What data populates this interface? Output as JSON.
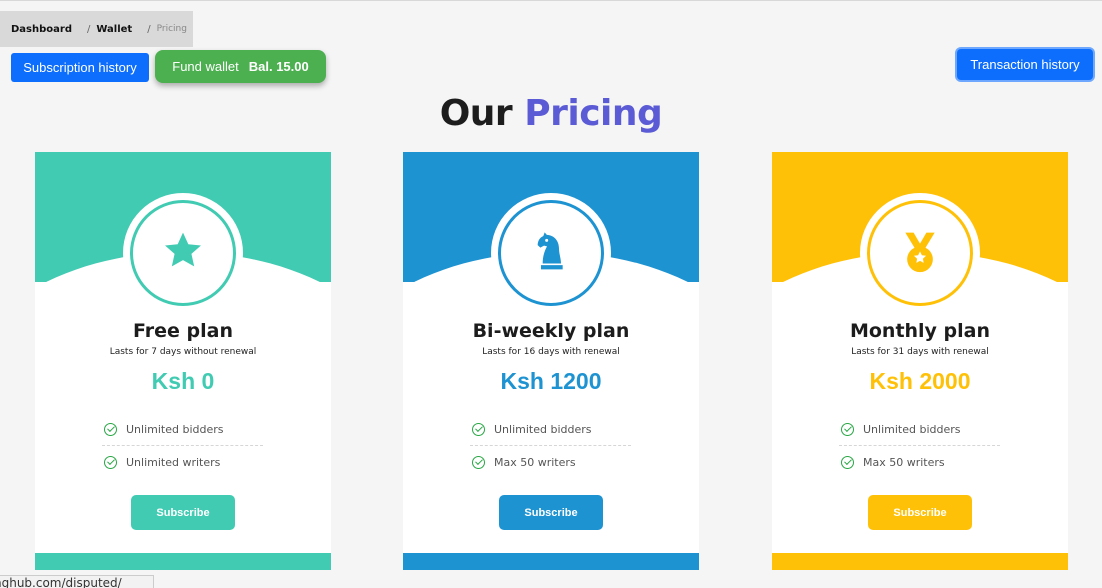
{
  "breadcrumb": {
    "items": [
      "Dashboard",
      "Wallet",
      "Pricing"
    ],
    "separator": "/"
  },
  "toolbar": {
    "subscription_history": "Subscription history",
    "fund_wallet": "Fund wallet",
    "balance": "Bal. 15.00",
    "transaction_history": "Transaction history"
  },
  "heading": {
    "part1": "Our",
    "part2": "Pricing"
  },
  "plans": [
    {
      "name": "Free plan",
      "description": "Lasts for 7 days without renewal",
      "price": "Ksh 0",
      "features": [
        "Unlimited bidders",
        "Unlimited writers"
      ],
      "cta": "Subscribe",
      "color": "#41cbb2",
      "icon": "star-icon"
    },
    {
      "name": "Bi-weekly plan",
      "description": "Lasts for 16 days with renewal",
      "price": "Ksh 1200",
      "features": [
        "Unlimited bidders",
        "Max 50 writers"
      ],
      "cta": "Subscribe",
      "color": "#1e93d2",
      "icon": "chess-knight-icon"
    },
    {
      "name": "Monthly plan",
      "description": "Lasts for 31 days with renewal",
      "price": "Ksh 2000",
      "features": [
        "Unlimited bidders",
        "Max 50 writers"
      ],
      "cta": "Subscribe",
      "color": "#ffc107",
      "icon": "medal-icon"
    }
  ],
  "status_bar": {
    "url": "nghub.com/disputed/"
  },
  "colors": {
    "primary_button": "#0d6efd",
    "fund_button": "#4caf50",
    "accent_heading": "#5b5bd6",
    "check": "#28a745"
  }
}
